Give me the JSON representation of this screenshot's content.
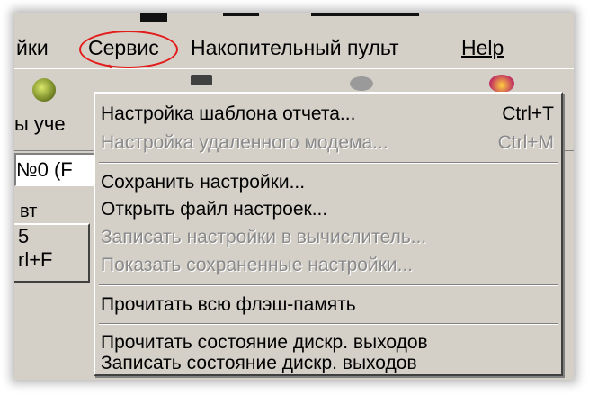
{
  "menubar": {
    "partial_item_label": "йки",
    "service_label": "Сервис",
    "accumulator_label": "Накопительный пульт",
    "help_label": "Help"
  },
  "toolbar": {
    "partial_label": "ы уче"
  },
  "left_panel": {
    "field_label": "№0 (F",
    "partial_text": "вт",
    "button_digit": "5",
    "button_shortcut": "rl+F"
  },
  "dropdown": {
    "items": [
      {
        "label": "Настройка шаблона отчета...",
        "shortcut": "Ctrl+T",
        "enabled": true
      },
      {
        "label": "Настройка удаленного модема...",
        "shortcut": "Ctrl+M",
        "enabled": false
      },
      {
        "label": "Сохранить настройки...",
        "shortcut": "",
        "enabled": true
      },
      {
        "label": "Открыть файл настроек...",
        "shortcut": "",
        "enabled": true
      },
      {
        "label": "Записать настройки в вычислитель...",
        "shortcut": "",
        "enabled": false
      },
      {
        "label": "Показать сохраненные настройки...",
        "shortcut": "",
        "enabled": false
      },
      {
        "label": "Прочитать всю флэш-память",
        "shortcut": "",
        "enabled": true
      },
      {
        "label": "Прочитать состояние дискр. выходов",
        "shortcut": "",
        "enabled": true
      },
      {
        "label": "Записать состояние дискр. выходов",
        "shortcut": "",
        "enabled": true
      }
    ]
  },
  "colors": {
    "highlight_red": "#e31b1b",
    "face": "#d4d0c8",
    "disabled_text": "#8a8a8a"
  }
}
